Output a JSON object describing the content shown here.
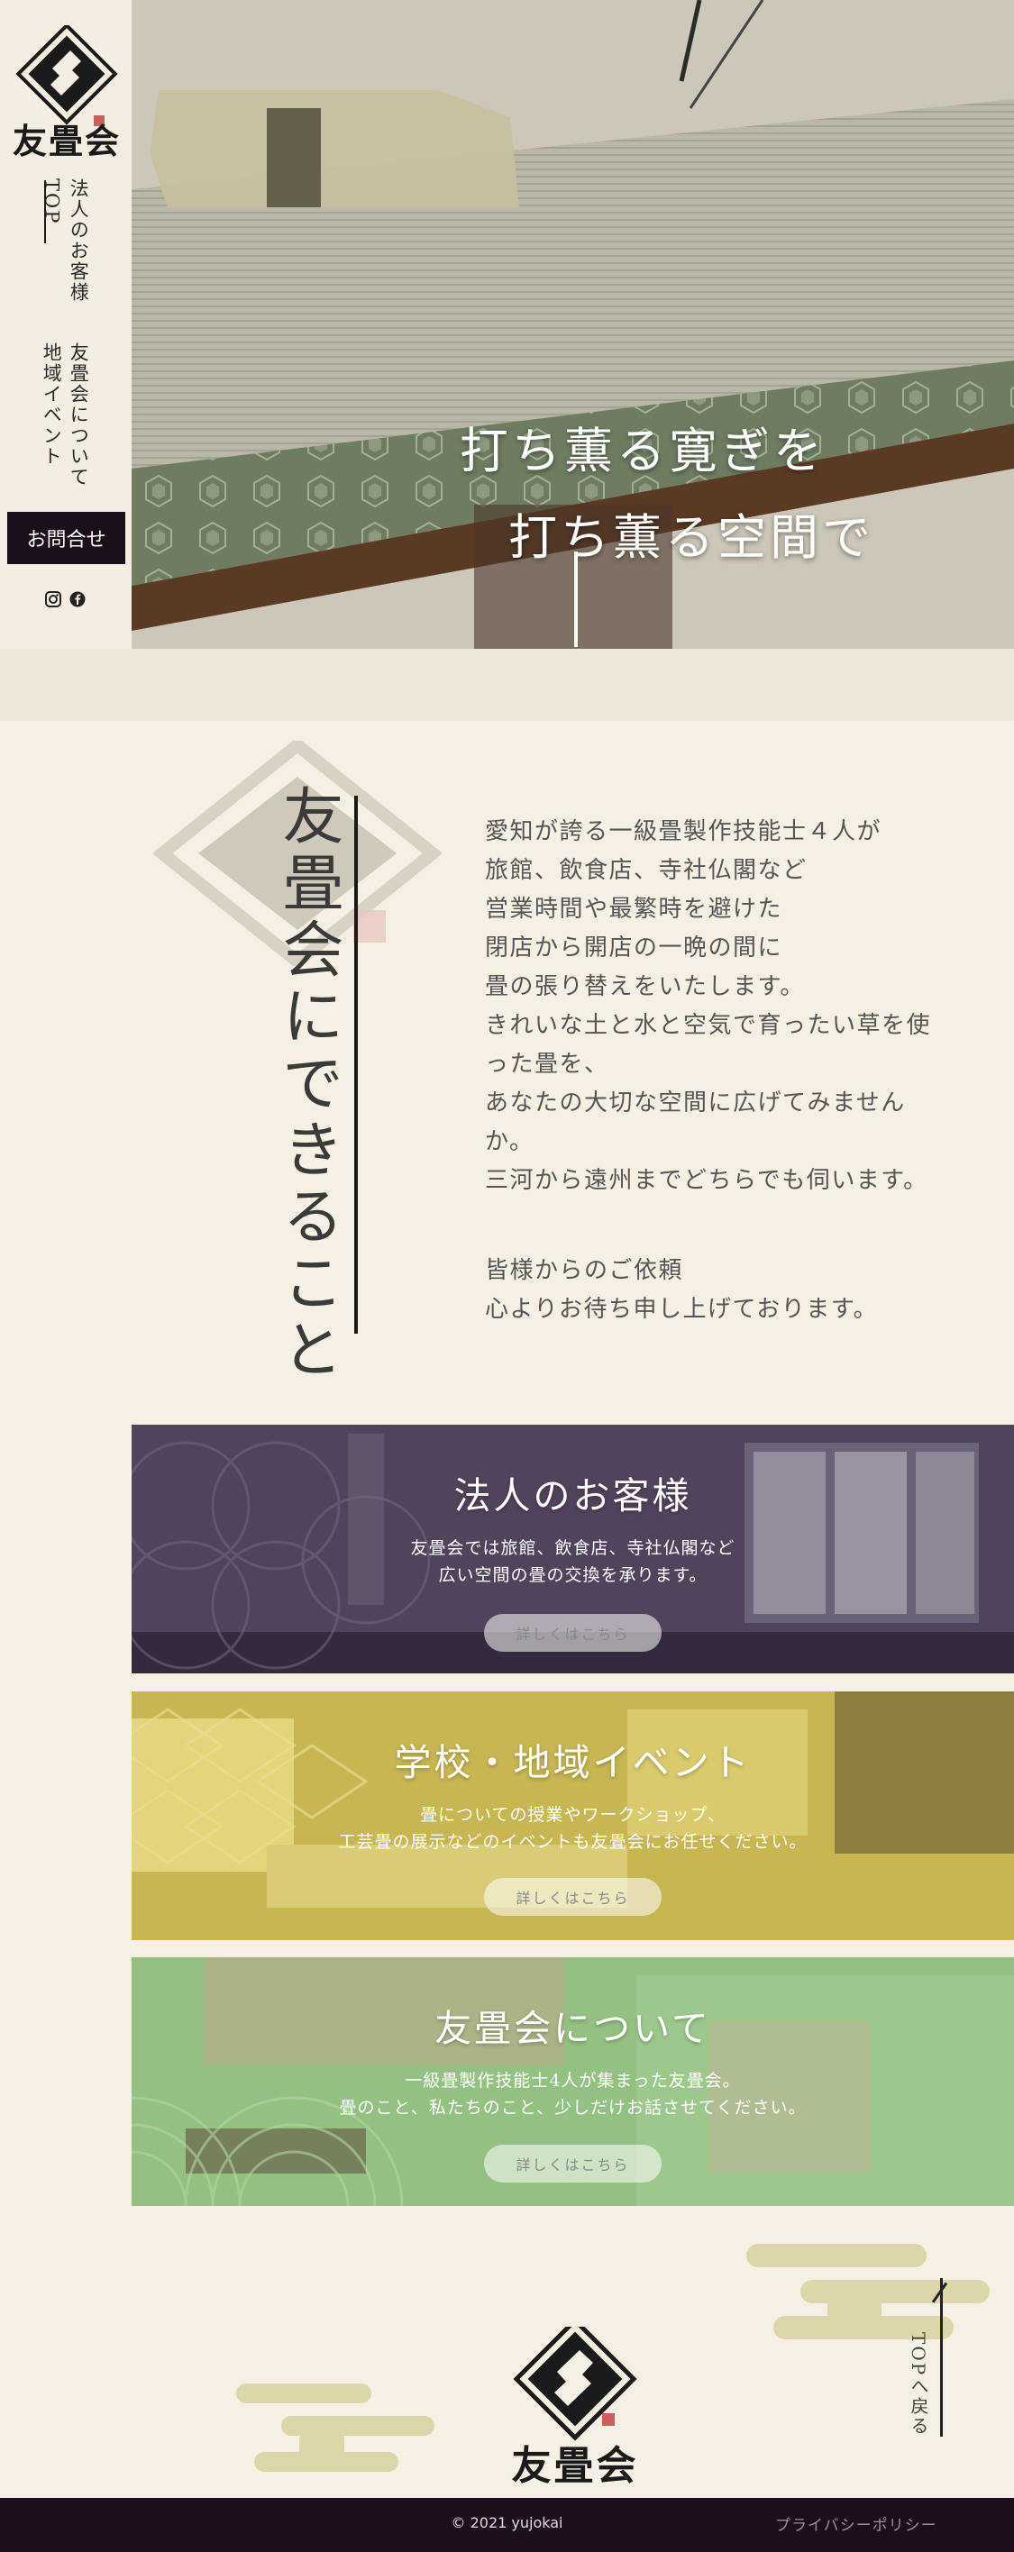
{
  "brand": {
    "name": "友畳会"
  },
  "nav": {
    "top": "TOP",
    "business": "法人のお客様",
    "school": "地域イベント",
    "about": "友畳会について",
    "contact": "お問合せ"
  },
  "social": {
    "icons": [
      "instagram-icon",
      "facebook-icon"
    ]
  },
  "hero": {
    "line1": "打ち薫る寛ぎを",
    "line2": "打ち薫る空間で"
  },
  "intro": {
    "title": "友畳会にできること",
    "paragraph": [
      "愛知が誇る一級畳製作技能士４人が",
      "旅館、飲食店、寺社仏閣など",
      "営業時間や最繁時を避けた",
      "閉店から開店の一晩の間に",
      "畳の張り替えをいたします。",
      "きれいな土と水と空気で育ったい草を使",
      "った畳を、",
      "あなたの大切な空間に広げてみません",
      "か。",
      "三河から遠州までどちらでも伺います。",
      "",
      "皆様からのご依頼",
      "心よりお待ち申し上げております。"
    ]
  },
  "cards": [
    {
      "title": "法人のお客様",
      "desc1": "友畳会では旅館、飲食店、寺社仏閣など",
      "desc2": "広い空間の畳の交換を承ります。",
      "button": "詳しくはこちら"
    },
    {
      "title": "学校・地域イベント",
      "desc1": "畳についての授業やワークショップ、",
      "desc2": "工芸畳の展示などのイベントも友畳会にお任せください。",
      "button": "詳しくはこちら"
    },
    {
      "title": "友畳会について",
      "desc1": "一級畳製作技能士4人が集まった友畳会。",
      "desc2": "畳のこと、私たちのこと、少しだけお話させてください。",
      "button": "詳しくはこちら"
    }
  ],
  "footer": {
    "totop": "TOPへ戻る",
    "copyright": "© 2021 yujokai",
    "privacy": "プライバシーポリシー"
  },
  "colors": {
    "background": "#f5f0e3",
    "dark": "#1e0d1c",
    "card1_overlay": "#5a4a6a",
    "card2_overlay": "#c8b84a",
    "card3_overlay": "#8ab67a",
    "cloud": "#dcd6a8"
  }
}
